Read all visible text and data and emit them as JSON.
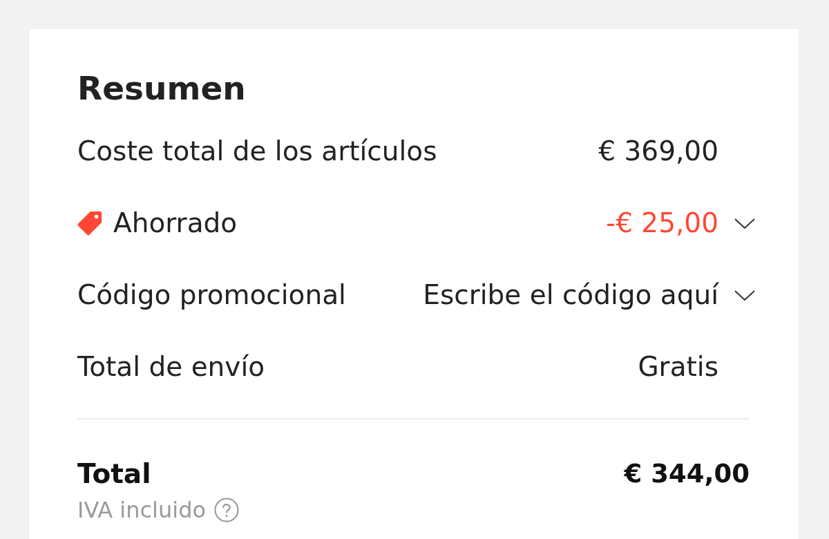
{
  "summary": {
    "title": "Resumen",
    "rows": [
      {
        "kind": "plain",
        "label": "Coste total de los artículos",
        "value": "€ 369,00",
        "expandable": false
      },
      {
        "kind": "discount",
        "label": "Ahorrado",
        "value": "-€ 25,00",
        "expandable": true
      },
      {
        "kind": "promo",
        "label": "Código promocional",
        "value": "Escribe el código aquí",
        "expandable": true
      },
      {
        "kind": "plain",
        "label": "Total de envío",
        "value": "Gratis",
        "expandable": false
      }
    ],
    "total": {
      "label": "Total",
      "value": "€ 344,00",
      "note": "IVA incluido"
    }
  }
}
